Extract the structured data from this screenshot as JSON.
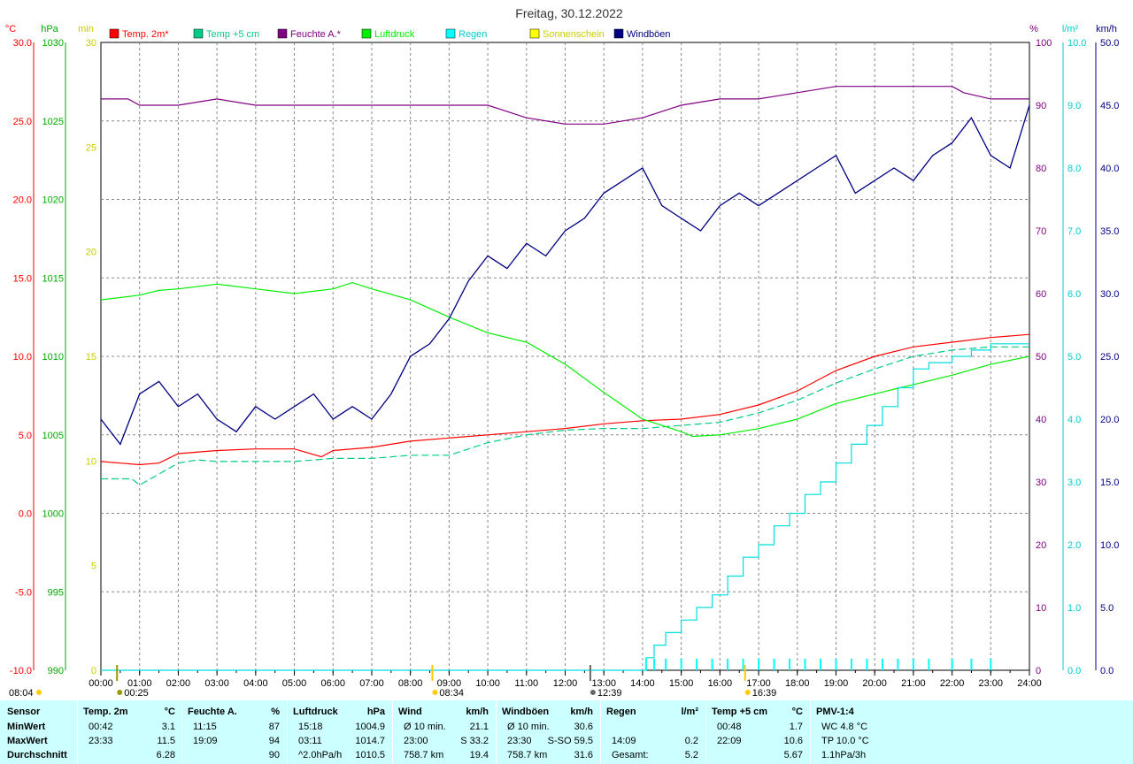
{
  "title": "Freitag, 30.12.2022",
  "axes": {
    "temp": {
      "unit": "°C",
      "ticks": [
        "30.0",
        "25.0",
        "20.0",
        "15.0",
        "10.0",
        "5.0",
        "0.0",
        "-5.0",
        "-10.0"
      ],
      "range": [
        -10,
        30
      ]
    },
    "press": {
      "unit": "hPa",
      "ticks": [
        "1030",
        "1025",
        "1020",
        "1015",
        "1010",
        "1005",
        "1000",
        "995",
        "990"
      ],
      "range": [
        990,
        1030
      ]
    },
    "sun": {
      "unit": "min",
      "ticks": [
        "30",
        "25",
        "20",
        "15",
        "10",
        "5",
        "0"
      ],
      "range": [
        0,
        30
      ]
    },
    "hum": {
      "unit": "%",
      "ticks": [
        "100",
        "90",
        "80",
        "70",
        "60",
        "50",
        "40",
        "30",
        "20",
        "10",
        "0"
      ],
      "range": [
        0,
        100
      ]
    },
    "rain": {
      "unit": "l/m²",
      "ticks": [
        "10.0",
        "9.0",
        "8.0",
        "7.0",
        "6.0",
        "5.0",
        "4.0",
        "3.0",
        "2.0",
        "1.0",
        "0.0"
      ],
      "range": [
        0,
        10
      ]
    },
    "wind": {
      "unit": "km/h",
      "ticks": [
        "50.0",
        "45.0",
        "40.0",
        "35.0",
        "30.0",
        "25.0",
        "20.0",
        "15.0",
        "10.0",
        "5.0",
        "0.0"
      ],
      "range": [
        0,
        50
      ]
    },
    "x_ticks": [
      "00:00",
      "01:00",
      "02:00",
      "03:00",
      "04:00",
      "05:00",
      "06:00",
      "07:00",
      "08:00",
      "09:00",
      "10:00",
      "11:00",
      "12:00",
      "13:00",
      "14:00",
      "15:00",
      "16:00",
      "17:00",
      "18:00",
      "19:00",
      "20:00",
      "21:00",
      "22:00",
      "23:00",
      "24:00"
    ]
  },
  "legend": [
    {
      "label": "Temp. 2m*",
      "color": "#ff0000"
    },
    {
      "label": "Temp +5 cm",
      "color": "#00cc88"
    },
    {
      "label": "Feuchte A.*",
      "color": "#800080"
    },
    {
      "label": "Luftdruck",
      "color": "#00ee00"
    },
    {
      "label": "Regen",
      "color": "#00ffff"
    },
    {
      "label": "Sonnenschein",
      "color": "#ffff00"
    },
    {
      "label": "Windböen",
      "color": "#000080"
    }
  ],
  "time_marks": [
    {
      "label": "08:04",
      "time": "08:04",
      "icon": "sunrise"
    },
    {
      "label": "00:25",
      "time": "00:25",
      "icon": "moonrise"
    },
    {
      "label": "08:34",
      "time": "08:34",
      "icon": "sun"
    },
    {
      "label": "12:39",
      "time": "12:39",
      "icon": "moon"
    },
    {
      "label": "16:39",
      "time": "16:39",
      "icon": "sunset"
    }
  ],
  "chart_data": {
    "type": "line",
    "title": "Freitag, 30.12.2022",
    "xlim": [
      "00:00",
      "24:00"
    ],
    "series": [
      {
        "name": "Temp. 2m*",
        "unit": "°C",
        "x": [
          0,
          0.5,
          1,
          1.5,
          2,
          3,
          4,
          5,
          5.7,
          6,
          7,
          8,
          9,
          10,
          11,
          12,
          13,
          14,
          15,
          16,
          17,
          18,
          19,
          20,
          21,
          22,
          23,
          24
        ],
        "y": [
          3.3,
          3.2,
          3.1,
          3.2,
          3.8,
          4.0,
          4.1,
          4.1,
          3.6,
          4.0,
          4.2,
          4.6,
          4.8,
          5.0,
          5.2,
          5.4,
          5.7,
          5.9,
          6.0,
          6.3,
          6.9,
          7.8,
          9.1,
          10.0,
          10.6,
          10.9,
          11.2,
          11.4
        ]
      },
      {
        "name": "Temp +5 cm",
        "unit": "°C",
        "x": [
          0,
          0.8,
          1,
          2,
          2.5,
          3,
          4,
          5,
          6,
          7,
          8,
          9,
          10,
          11,
          12,
          13,
          14,
          15,
          16,
          17,
          18,
          19,
          20,
          21,
          22,
          23,
          24
        ],
        "y": [
          2.2,
          2.2,
          1.8,
          3.2,
          3.4,
          3.3,
          3.3,
          3.3,
          3.5,
          3.5,
          3.7,
          3.7,
          4.5,
          5.0,
          5.3,
          5.4,
          5.4,
          5.6,
          5.8,
          6.4,
          7.2,
          8.3,
          9.2,
          10.0,
          10.4,
          10.6,
          10.6
        ]
      },
      {
        "name": "Feuchte A.*",
        "unit": "%",
        "x": [
          0,
          0.7,
          1,
          2,
          3,
          4,
          5,
          6,
          7,
          8,
          9,
          10,
          10.5,
          11,
          12,
          13,
          14,
          14.5,
          15,
          16,
          17,
          18,
          19,
          20,
          21,
          22,
          22.3,
          23,
          24
        ],
        "y": [
          91,
          91,
          90,
          90,
          91,
          90,
          90,
          90,
          90,
          90,
          90,
          90,
          89,
          88,
          87,
          87,
          88,
          89,
          90,
          91,
          91,
          92,
          93,
          93,
          93,
          93,
          92,
          91,
          91
        ]
      },
      {
        "name": "Luftdruck",
        "unit": "hPa",
        "x": [
          0,
          1,
          1.5,
          2,
          3,
          4,
          5,
          6,
          6.5,
          7,
          8,
          9,
          10,
          11,
          12,
          13,
          14,
          15,
          15.3,
          16,
          17,
          18,
          19,
          20,
          21,
          22,
          23,
          24
        ],
        "y": [
          1013.6,
          1013.9,
          1014.2,
          1014.3,
          1014.6,
          1014.3,
          1014.0,
          1014.3,
          1014.7,
          1014.3,
          1013.6,
          1012.5,
          1011.5,
          1010.9,
          1009.5,
          1007.7,
          1006.0,
          1005.2,
          1004.9,
          1005.0,
          1005.4,
          1006.0,
          1007.0,
          1007.6,
          1008.2,
          1008.8,
          1009.5,
          1010.0
        ]
      },
      {
        "name": "Regen",
        "unit": "l/m²",
        "x": [
          0,
          14.09,
          14.3,
          14.6,
          15,
          15.4,
          15.8,
          16.2,
          16.6,
          17,
          17.4,
          17.8,
          18.2,
          18.6,
          19,
          19.4,
          19.8,
          20.2,
          20.6,
          21,
          21.4,
          22,
          22.5,
          23,
          24
        ],
        "y": [
          0,
          0.2,
          0.4,
          0.6,
          0.8,
          1.0,
          1.2,
          1.5,
          1.8,
          2.0,
          2.3,
          2.5,
          2.8,
          3.0,
          3.3,
          3.6,
          3.9,
          4.2,
          4.5,
          4.8,
          4.9,
          5.0,
          5.1,
          5.2,
          5.2
        ]
      },
      {
        "name": "Windböen",
        "unit": "km/h",
        "x": [
          0,
          0.5,
          1,
          1.5,
          2,
          2.5,
          3,
          3.5,
          4,
          4.5,
          5,
          5.5,
          6,
          6.5,
          7,
          7.5,
          8,
          8.5,
          9,
          9.5,
          10,
          10.5,
          11,
          11.5,
          12,
          12.5,
          13,
          13.5,
          14,
          14.5,
          15,
          15.5,
          16,
          16.5,
          17,
          17.5,
          18,
          18.5,
          19,
          19.5,
          20,
          20.5,
          21,
          21.5,
          22,
          22.5,
          23,
          23.5,
          24
        ],
        "y": [
          20,
          18,
          22,
          23,
          21,
          22,
          20,
          19,
          21,
          20,
          21,
          22,
          20,
          21,
          20,
          22,
          25,
          26,
          28,
          31,
          33,
          32,
          34,
          33,
          35,
          36,
          38,
          39,
          40,
          37,
          36,
          35,
          37,
          38,
          37,
          38,
          39,
          40,
          41,
          38,
          39,
          40,
          39,
          41,
          42,
          44,
          41,
          40,
          45
        ]
      }
    ]
  },
  "table": {
    "row_labels": [
      "Sensor",
      "MinWert",
      "MaxWert",
      "Durchschnitt"
    ],
    "columns": [
      {
        "name": "Temp. 2m",
        "unit": "°C",
        "rows": [
          [
            "00:42",
            "3.1"
          ],
          [
            "23:33",
            "11.5"
          ],
          [
            "",
            "6.28"
          ]
        ]
      },
      {
        "name": "Feuchte A.",
        "unit": "%",
        "rows": [
          [
            "11:15",
            "87"
          ],
          [
            "19:09",
            "94"
          ],
          [
            "",
            "90"
          ]
        ]
      },
      {
        "name": "Luftdruck",
        "unit": "hPa",
        "rows": [
          [
            "15:18",
            "1004.9"
          ],
          [
            "03:11",
            "1014.7"
          ],
          [
            "^2.0hPa/h",
            "1010.5"
          ]
        ]
      },
      {
        "name": "Wind",
        "unit": "km/h",
        "rows": [
          [
            "Ø 10 min.",
            "21.1"
          ],
          [
            "23:00",
            "S 33.2"
          ],
          [
            "758.7 km",
            "19.4"
          ]
        ]
      },
      {
        "name": "Windböen",
        "unit": "km/h",
        "rows": [
          [
            "Ø 10 min.",
            "30.6"
          ],
          [
            "23:30",
            "S-SO 59.5"
          ],
          [
            "758.7 km",
            "31.6"
          ]
        ]
      },
      {
        "name": "Regen",
        "unit": "l/m²",
        "rows": [
          [
            "",
            ""
          ],
          [
            "14:09",
            "0.2"
          ],
          [
            "Gesamt:",
            "5.2"
          ]
        ]
      },
      {
        "name": "Temp +5 cm",
        "unit": "°C",
        "rows": [
          [
            "00:48",
            "1.7"
          ],
          [
            "22:09",
            "10.6"
          ],
          [
            "",
            "5.67"
          ]
        ]
      },
      {
        "name": "PMV-1:4",
        "unit": "",
        "rows": [
          [
            "WC 4.8 °C",
            ""
          ],
          [
            "TP 10.0 °C",
            ""
          ],
          [
            "1.1hPa/3h",
            ""
          ]
        ]
      }
    ]
  }
}
